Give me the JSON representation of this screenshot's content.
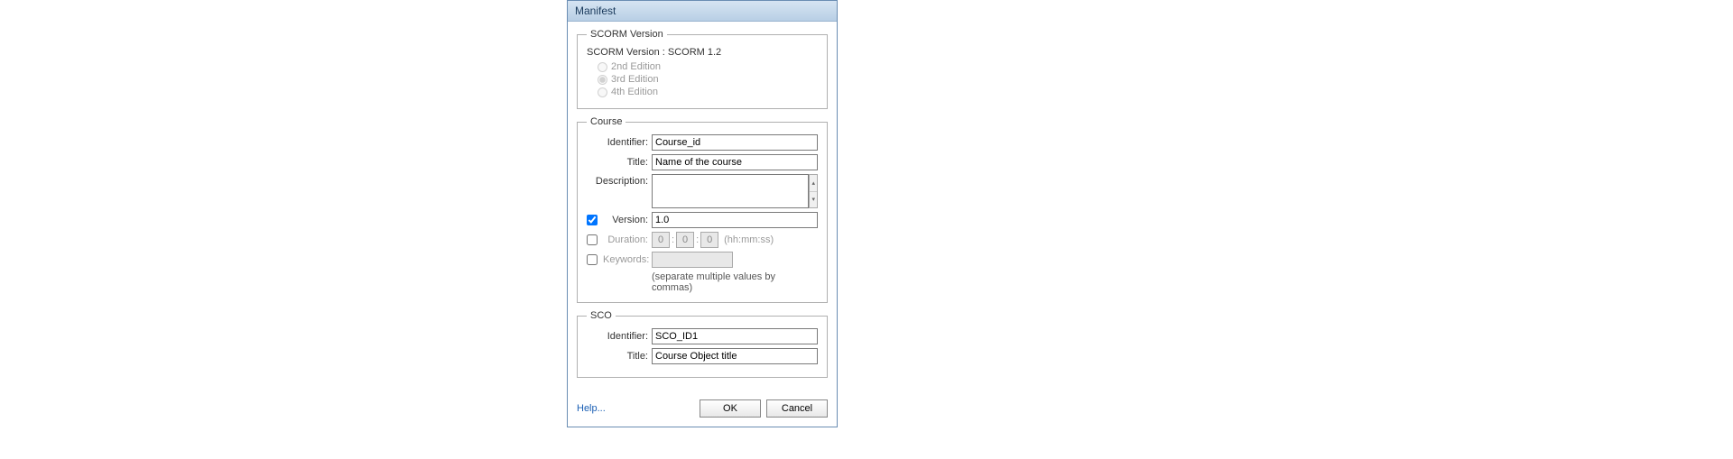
{
  "dialog": {
    "title": "Manifest"
  },
  "scorm": {
    "legend": "SCORM Version",
    "label": "SCORM Version : SCORM 1.2",
    "editions": {
      "e1": "2nd Edition",
      "e2": "3rd Edition",
      "e3": "4th Edition"
    }
  },
  "course": {
    "legend": "Course",
    "identifier_label": "Identifier:",
    "identifier_value": "Course_id",
    "title_label": "Title:",
    "title_value": "Name of the course",
    "description_label": "Description:",
    "description_value": "",
    "version_label": "Version:",
    "version_value": "1.0",
    "duration_label": "Duration:",
    "duration_h": "0",
    "duration_m": "0",
    "duration_s": "0",
    "duration_hint": "(hh:mm:ss)",
    "keywords_label": "Keywords:",
    "keywords_value": "",
    "keywords_hint": "(separate multiple values by commas)"
  },
  "sco": {
    "legend": "SCO",
    "identifier_label": "Identifier:",
    "identifier_value": "SCO_ID1",
    "title_label": "Title:",
    "title_value": "Course Object title"
  },
  "footer": {
    "help": "Help...",
    "ok": "OK",
    "cancel": "Cancel"
  }
}
